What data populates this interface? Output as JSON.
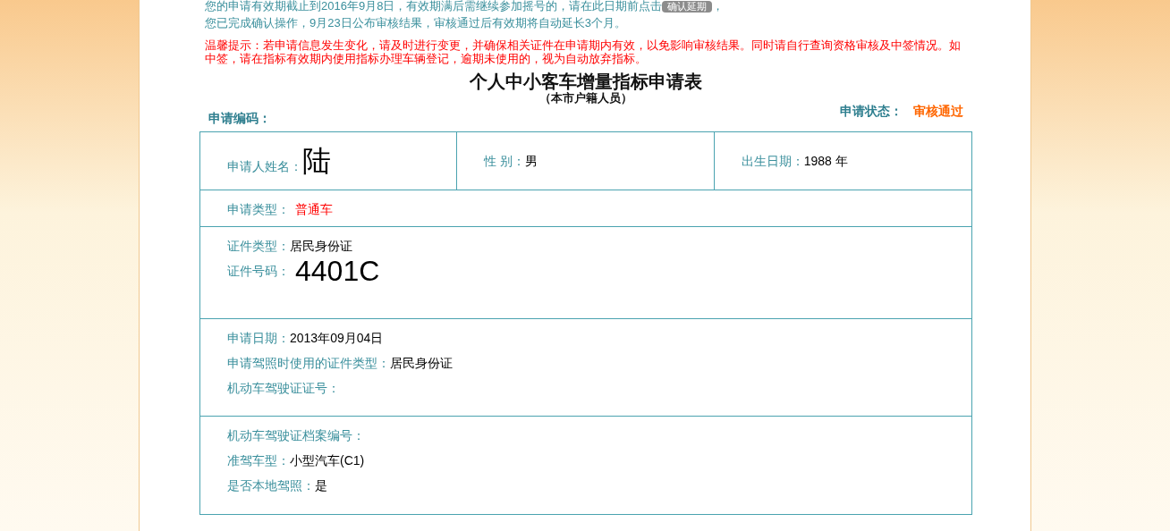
{
  "notice": {
    "line1": "您的申请有效期截止到2016年9月8日，有效期满后需继续参加摇号的，请在此日期前点击",
    "button": "确认延期",
    "line1_end": "，",
    "line2": "您已完成确认操作，9月23日公布审核结果，审核通过后有效期将自动延长3个月。"
  },
  "warning": "温馨提示：若申请信息发生变化，请及时进行变更，并确保相关证件在申请期内有效，以免影响审核结果。同时请自行查询资格审核及中签情况。如中签，请在指标有效期内使用指标办理车辆登记，逾期未使用的，视为自动放弃指标。",
  "form": {
    "title": "个人中小客车增量指标申请表",
    "subtitle": "（本市户籍人员）",
    "code_label": "申请编码：",
    "status_label": "申请状态：",
    "status_value": "审核通过",
    "rows": [
      {
        "kind": "columns",
        "fields": [
          {
            "label": "申请人姓名：",
            "value": "陆",
            "kind": "large"
          },
          {
            "label": "性 别：",
            "value": "男",
            "kind": "plain"
          },
          {
            "label": "出生日期：",
            "value": "1988 年",
            "kind": "plain"
          }
        ]
      },
      {
        "kind": "stack",
        "fields": [
          {
            "label": "申请类型：",
            "value": "普通车",
            "kind": "alert"
          }
        ]
      },
      {
        "kind": "stack",
        "fields": [
          {
            "label": "证件类型：",
            "value": "居民身份证",
            "kind": "plain"
          },
          {
            "label": "证件号码：",
            "value": "4401C",
            "kind": "large"
          }
        ]
      },
      {
        "kind": "stack",
        "fields": [
          {
            "label": "申请日期：",
            "value": "2013年09月04日",
            "kind": "plain"
          },
          {
            "label": "申请驾照时使用的证件类型：",
            "value": "居民身份证",
            "kind": "plain"
          },
          {
            "label": "机动车驾驶证证号："
          }
        ]
      },
      {
        "kind": "stack",
        "fields": [
          {
            "label": "机动车驾驶证档案编号："
          },
          {
            "label": "准驾车型：",
            "value": "小型汽车(C1)",
            "kind": "plain"
          },
          {
            "label": "是否本地驾照：",
            "value": "是",
            "kind": "plain"
          }
        ]
      }
    ]
  }
}
